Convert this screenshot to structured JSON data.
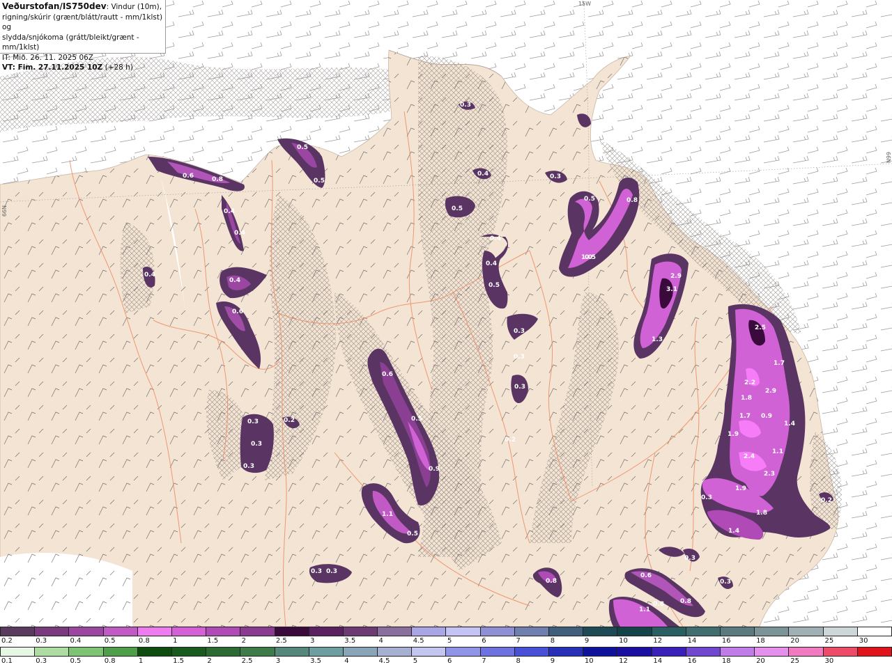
{
  "header": {
    "brand": "Veðurstofan/IS750dev",
    "line1_rest": ": Vindur (10m),",
    "line2": "rigning/skúrir (grænt/blátt/rautt - mm/1klst) og",
    "line3": "slydda/snjókoma (grátt/bleikt/grænt - mm/1klst)",
    "it_line": "IT: Mið. 26. 11. 2025 06Z",
    "vt_line": "VT: Fim. 27.11.2025 10Z",
    "vt_offset": "(+28 h)"
  },
  "grid_labels": {
    "top": "15W",
    "right": "66N",
    "left": "66N"
  },
  "colors": {
    "land": "#f3e4d4",
    "sea": "#ffffff",
    "roads": "#f08a62",
    "precip_light": "#5a3563",
    "precip_mid": "#8a3f92",
    "precip_strong": "#d062d6",
    "precip_peak": "#f67df7"
  },
  "precip_labels": [
    "0.3",
    "0.5",
    "0.5",
    "0.6",
    "0.8",
    "0.4",
    "0.4",
    "0.4",
    "0.4",
    "0.4",
    "0.6",
    "0.5",
    "0.4",
    "0.3",
    "0.5",
    "0.8",
    "0.4",
    "0.5",
    "0.5",
    "1.0",
    "2.9",
    "3.1",
    "1.3",
    "0.3",
    "0.3",
    "0.3",
    "0.6",
    "0.5",
    "0.9",
    "0.3",
    "0.3",
    "0.3",
    "0.2",
    "0.2",
    "1.1",
    "0.5",
    "0.3",
    "0.3",
    "2.5",
    "1.7",
    "2.2",
    "2.9",
    "1.8",
    "1.7",
    "0.9",
    "1.4",
    "1.9",
    "2.4",
    "1.1",
    "2.3",
    "1.9",
    "0.3",
    "1.8",
    "1.4",
    "0.2",
    "0.3",
    "0.8",
    "0.6",
    "0.8",
    "1.1",
    "0.8",
    "0.3"
  ],
  "legend_top": {
    "colors": [
      "#5a3a5e",
      "#7a3b7e",
      "#9b46a0",
      "#c25ac6",
      "#ee7cf0",
      "#d45fd7",
      "#b04ab6",
      "#8a3a90",
      "#3a0a3c",
      "#5a2060",
      "#6d3a73",
      "#8a6f9e",
      "#a9a5e6",
      "#c5c2f6",
      "#8f8fd6",
      "#6e7fb0",
      "#405f7a",
      "#1e4a55",
      "#14434a",
      "#295e63",
      "#3f6d70",
      "#5a7a80",
      "#7a9498",
      "#a0b0b4",
      "#cdd7d9",
      "#ffffff"
    ],
    "labels": [
      "0.2",
      "0.3",
      "0.4",
      "0.5",
      "0.8",
      "1",
      "1.5",
      "2",
      "2.5",
      "3",
      "3.5",
      "4",
      "4.5",
      "5",
      "6",
      "7",
      "8",
      "9",
      "10",
      "12",
      "14",
      "16",
      "18",
      "20",
      "25",
      "30"
    ]
  },
  "legend_bottom": {
    "colors": [
      "#e6f7e3",
      "#aedca2",
      "#7fc374",
      "#4f9e4a",
      "#0d4d0f",
      "#195a1e",
      "#2c6b34",
      "#3f7a4a",
      "#55877a",
      "#6f9ea0",
      "#8aa5b8",
      "#a6b0d0",
      "#c3c7ef",
      "#8f94e8",
      "#6d72e0",
      "#4a4fd8",
      "#2a2fb8",
      "#11129c",
      "#1a0fa0",
      "#3820b8",
      "#7048d0",
      "#c07de8",
      "#e690ee",
      "#f07bc0",
      "#ee4a6a",
      "#e0141c"
    ],
    "labels": [
      "0.1",
      "0.3",
      "0.5",
      "0.8",
      "1",
      "1.5",
      "2",
      "2.5",
      "3",
      "3.5",
      "4",
      "4.5",
      "5",
      "6",
      "7",
      "8",
      "9",
      "10",
      "12",
      "14",
      "16",
      "18",
      "20",
      "25",
      "30"
    ]
  }
}
